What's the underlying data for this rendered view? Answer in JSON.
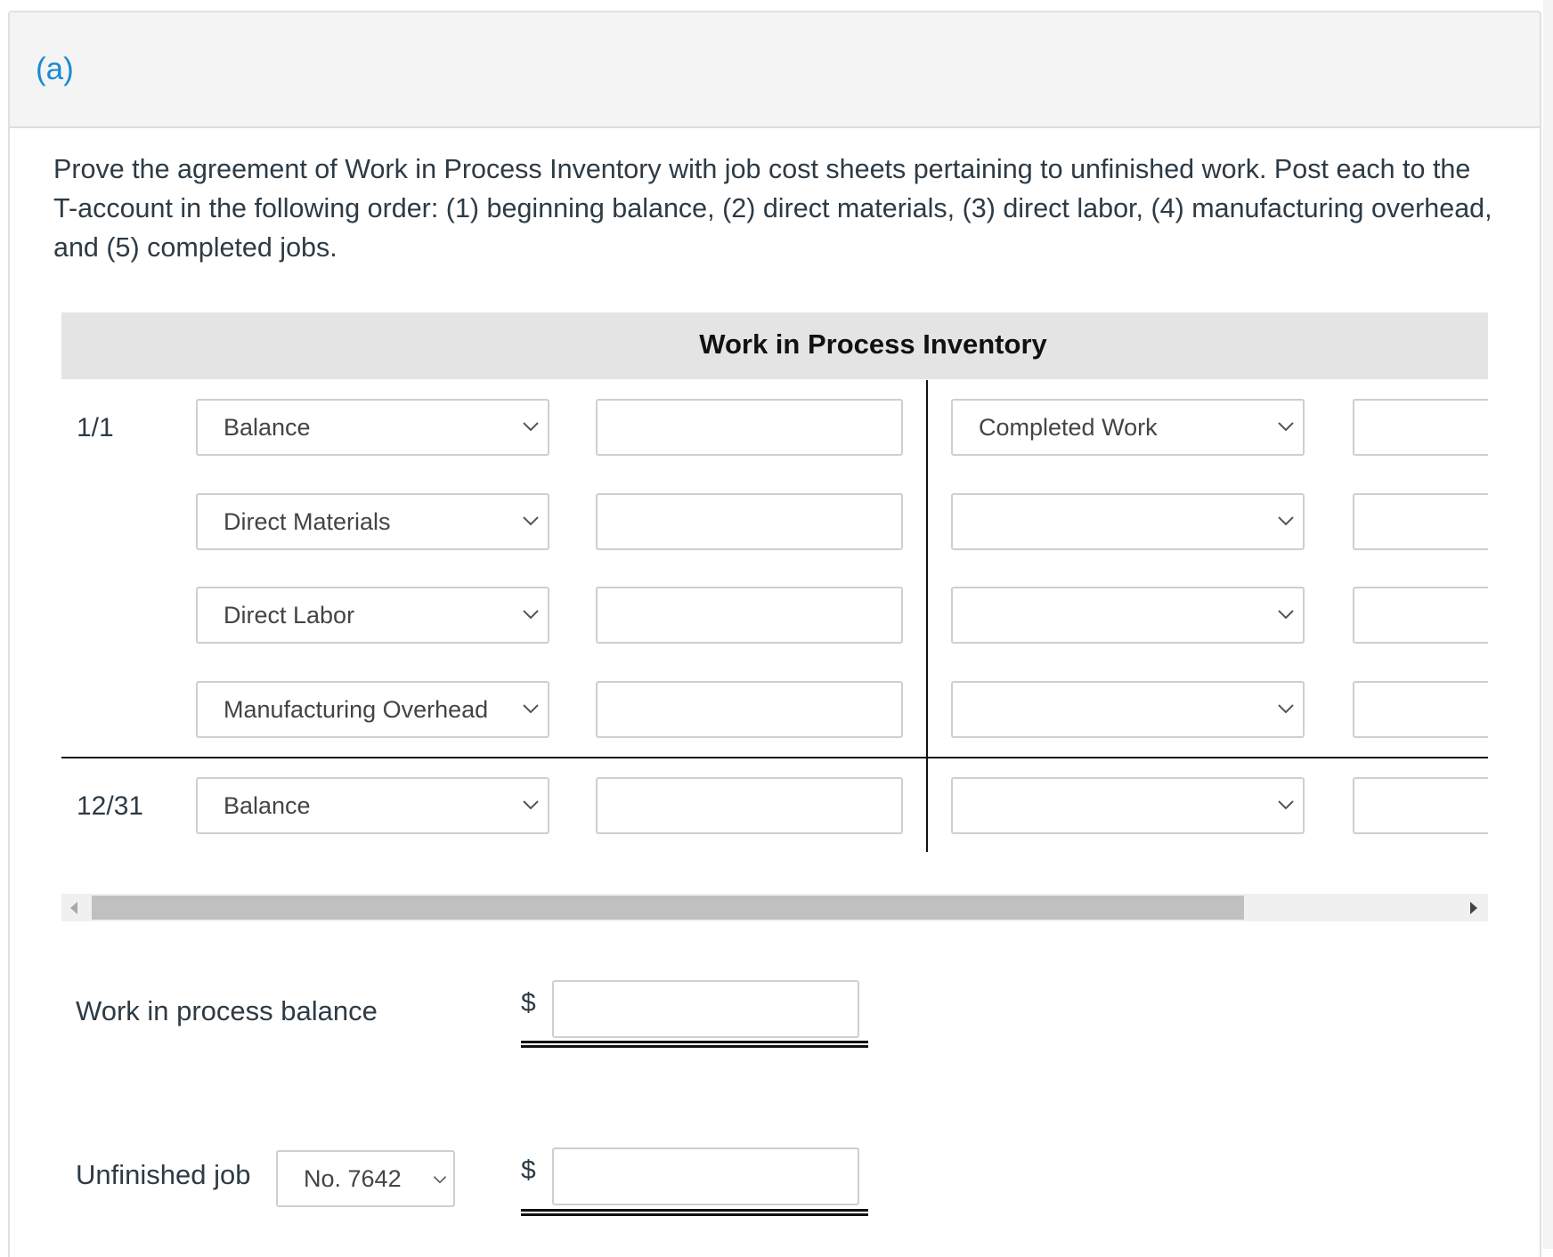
{
  "part": {
    "label": "(a)"
  },
  "prompt": "Prove the agreement of Work in Process Inventory with job cost sheets pertaining to unfinished work. Post each to the T-account in the following order: (1) beginning balance, (2) direct materials, (3) direct labor, (4) manufacturing overhead, and (5) completed jobs.",
  "taccount": {
    "title": "Work in Process Inventory",
    "debit_rows": [
      {
        "date": "1/1",
        "account": "Balance",
        "amount": ""
      },
      {
        "date": "",
        "account": "Direct Materials",
        "amount": ""
      },
      {
        "date": "",
        "account": "Direct Labor",
        "amount": ""
      },
      {
        "date": "",
        "account": "Manufacturing Overhead",
        "amount": ""
      }
    ],
    "credit_rows": [
      {
        "account": "Completed Work",
        "amount": ""
      },
      {
        "account": "",
        "amount": ""
      },
      {
        "account": "",
        "amount": ""
      },
      {
        "account": "",
        "amount": ""
      }
    ],
    "ending": {
      "date": "12/31",
      "debit_account": "Balance",
      "debit_amount": "",
      "credit_account": "",
      "credit_amount": ""
    }
  },
  "scrollbar": {
    "position_fraction": 0.0,
    "visible_fraction": 0.84
  },
  "summary": {
    "wip_balance_label": "Work in process balance",
    "currency": "$",
    "wip_balance_value": "",
    "unfinished_job_label": "Unfinished job",
    "unfinished_job_selected": "No. 7642",
    "unfinished_job_value": ""
  }
}
